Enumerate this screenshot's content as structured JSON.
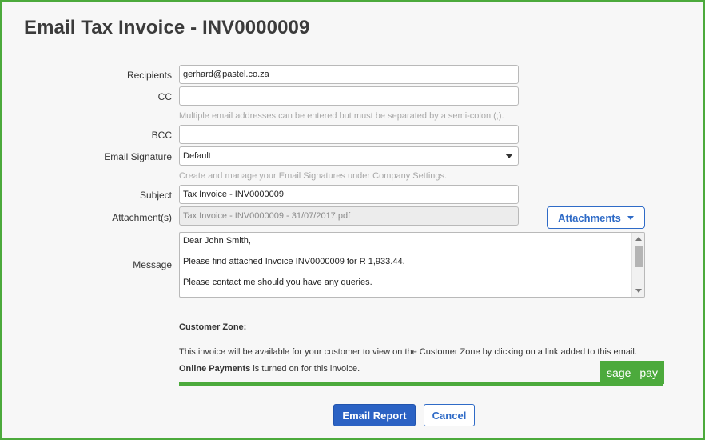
{
  "dialog": {
    "title": "Email Tax Invoice - INV0000009"
  },
  "form": {
    "recipients_label": "Recipients",
    "recipients_value": "gerhard@pastel.co.za",
    "cc_label": "CC",
    "cc_value": "",
    "cc_hint": "Multiple email addresses can be entered but must be separated by a semi-colon (;).",
    "bcc_label": "BCC",
    "bcc_value": "",
    "signature_label": "Email Signature",
    "signature_value": "Default",
    "signature_hint": "Create and manage your Email Signatures under Company Settings.",
    "subject_label": "Subject",
    "subject_value": "Tax Invoice - INV0000009",
    "attachments_label": "Attachment(s)",
    "attachments_value": "Tax Invoice - INV0000009 - 31/07/2017.pdf",
    "attachments_button": "Attachments",
    "message_label": "Message",
    "message_lines": [
      "Dear John Smith,",
      "Please find attached Invoice INV0000009 for R 1,933.44.",
      "Please contact me should you have any queries."
    ]
  },
  "customer_zone": {
    "title": "Customer Zone:",
    "text": "This invoice will be available for your customer to view on the Customer Zone by clicking on a link added to this email.",
    "online_payments_bold": "Online Payments",
    "online_payments_rest": " is turned on for this invoice.",
    "logo_left": "sage",
    "logo_right": "pay"
  },
  "actions": {
    "email_label": "Email Report",
    "cancel_label": "Cancel"
  },
  "colors": {
    "accent_green": "#4caa3c",
    "primary_blue": "#2b62c4"
  }
}
